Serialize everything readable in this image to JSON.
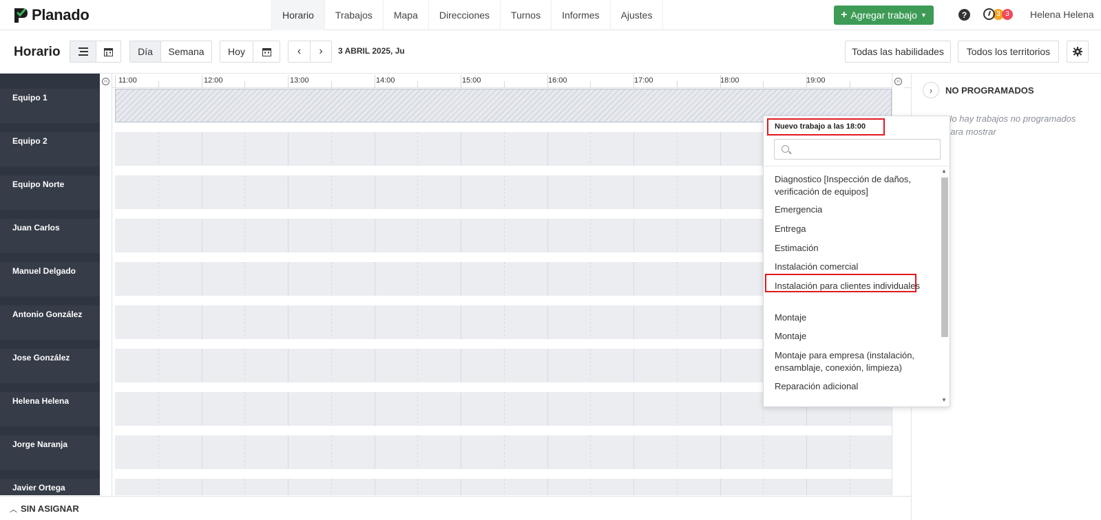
{
  "app": {
    "name": "Planado"
  },
  "nav": {
    "tabs": [
      "Horario",
      "Trabajos",
      "Mapa",
      "Direcciones",
      "Turnos",
      "Informes",
      "Ajustes"
    ],
    "active": "Horario",
    "add_job": "Agregar trabajo",
    "help": "?",
    "badges": [
      "3",
      "3"
    ],
    "user": "Helena Helena"
  },
  "toolbar": {
    "title": "Horario",
    "view_day": "Día",
    "view_week": "Semana",
    "today": "Hoy",
    "date": "3 ABRIL 2025, Ju",
    "skills": "Todas las habilidades",
    "territories": "Todos los territorios"
  },
  "timeline": {
    "hours": [
      "11:00",
      "12:00",
      "13:00",
      "14:00",
      "15:00",
      "16:00",
      "17:00",
      "18:00",
      "19:00"
    ]
  },
  "resources": [
    "Equipo 1",
    "Equipo 2",
    "Equipo Norte",
    "Juan Carlos",
    "Manuel Delgado",
    "Antonio González",
    "Jose González",
    "Helena Helena",
    "Jorge Naranja",
    "Javier Ortega"
  ],
  "right_panel": {
    "title": "NO PROGRAMADOS",
    "empty": "No hay trabajos no programados para mostrar"
  },
  "bottom": {
    "label": "SIN ASIGNAR"
  },
  "popup": {
    "title": "Nuevo trabajo a las 18:00",
    "search_placeholder": "",
    "options": [
      "Diagnostico [Inspección de daños, verificación de equipos]",
      "Emergencia",
      "Entrega",
      "Estimación",
      "Instalación comercial",
      "Instalación para clientes individuales",
      "Montaje",
      "Montaje",
      "Montaje para empresa (instalación, ensamblaje, conexión, limpieza)",
      "Reparación adicional"
    ],
    "highlighted": "Entrega"
  },
  "colors": {
    "accent_green": "#3d9b56",
    "highlight_red": "#e0191f",
    "sidebar": "#2f3541"
  }
}
